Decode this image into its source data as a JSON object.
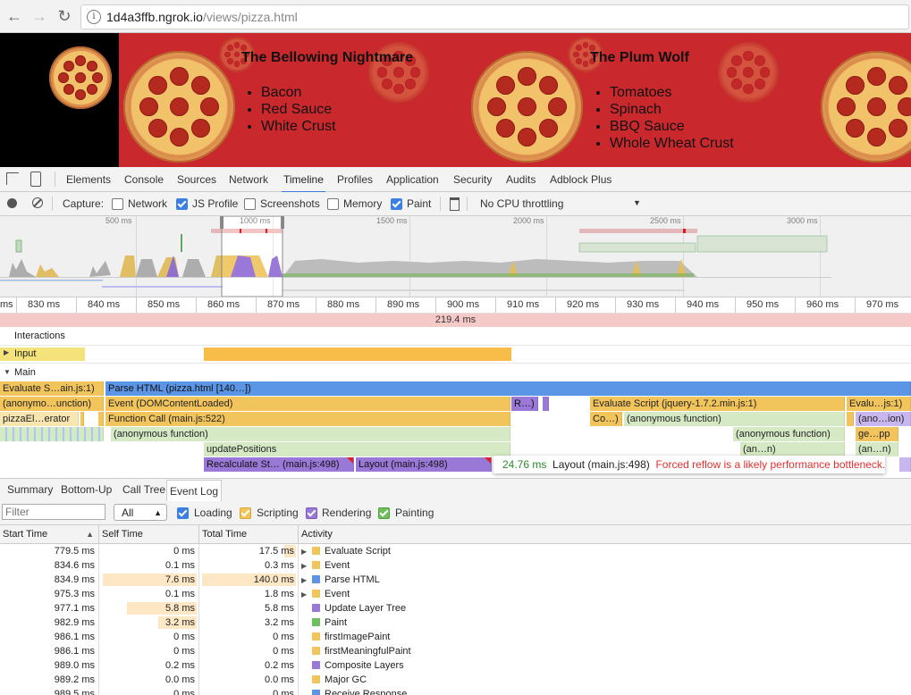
{
  "browser": {
    "url_host": "1d4a3ffb.ngrok.io",
    "url_path": "/views/pizza.html"
  },
  "page": {
    "pizzas": [
      {
        "name": "The Bellowing Nightmare",
        "ingredients": [
          "Bacon",
          "Red Sauce",
          "White Crust"
        ]
      },
      {
        "name": "The Plum Wolf",
        "ingredients": [
          "Tomatoes",
          "Spinach",
          "BBQ Sauce",
          "Whole Wheat Crust"
        ]
      }
    ]
  },
  "devtools": {
    "tabs": [
      "Elements",
      "Console",
      "Sources",
      "Network",
      "Timeline",
      "Profiles",
      "Application",
      "Security",
      "Audits",
      "Adblock Plus"
    ],
    "active_tab": "Timeline",
    "capture": {
      "label": "Capture:",
      "options": [
        {
          "label": "Network",
          "checked": false
        },
        {
          "label": "JS Profile",
          "checked": true
        },
        {
          "label": "Screenshots",
          "checked": false
        },
        {
          "label": "Memory",
          "checked": false
        },
        {
          "label": "Paint",
          "checked": true
        }
      ],
      "throttling": "No CPU throttling"
    },
    "overview_ticks": [
      "500 ms",
      "1000 ms",
      "1500 ms",
      "2000 ms",
      "2500 ms",
      "3000 ms"
    ],
    "ruler_ticks": [
      "ms",
      "830 ms",
      "840 ms",
      "850 ms",
      "860 ms",
      "870 ms",
      "880 ms",
      "890 ms",
      "900 ms",
      "910 ms",
      "920 ms",
      "930 ms",
      "940 ms",
      "950 ms",
      "960 ms",
      "970 ms"
    ],
    "selection_duration": "219.4 ms",
    "tracks": {
      "interactions": "Interactions",
      "input": "Input",
      "main": "Main"
    },
    "flame": {
      "evaluate_script_1": "Evaluate S…ain.js:1)",
      "parse_html": "Parse HTML (pizza.html [140…])",
      "anon_function_1": "(anonymo…unction)",
      "event_dom": "Event (DOMContentLoaded)",
      "r_short": "R…)",
      "evaluate_jquery": "Evaluate Script (jquery-1.7.2.min.js:1)",
      "evalu_js1": "Evalu…js:1)",
      "pizza_gen": "pizzaEl…erator",
      "function_call": "Function Call (main.js:522)",
      "co_short": "Co…)",
      "anon_function_2": "(anonymous function)",
      "ano_ion": "(ano…ion)",
      "anon_function_3": "(anonymous function)",
      "anon_function_4": "(anonymous function)",
      "ge_pp": "ge…pp",
      "update_positions": "updatePositions",
      "an_n_1": "(an…n)",
      "an_n_2": "(an…n)",
      "recalc": "Recalculate St… (main.js:498)",
      "layout": "Layout (main.js:498)"
    },
    "tooltip": {
      "time": "24.76 ms",
      "title": "Layout (main.js:498)",
      "warning": "Forced reflow is a likely performance bottleneck.",
      "time_color": "#2a8a2a",
      "warning_color": "#e03030"
    },
    "subtabs": [
      "Summary",
      "Bottom-Up",
      "Call Tree",
      "Event Log"
    ],
    "active_subtab": "Event Log",
    "filter_placeholder": "Filter",
    "filter_select": "All",
    "categories": [
      {
        "label": "Loading",
        "checked": true
      },
      {
        "label": "Scripting",
        "checked": true
      },
      {
        "label": "Rendering",
        "checked": true
      },
      {
        "label": "Painting",
        "checked": true
      }
    ],
    "columns": [
      "Start Time",
      "Self Time",
      "Total Time",
      "Activity"
    ],
    "rows": [
      {
        "start": "779.5 ms",
        "self": "0 ms",
        "total": "17.5 ms",
        "activity": "Evaluate Script",
        "expand": true,
        "color": "#f2c55c",
        "self_bar": 0,
        "total_bar": 0.12
      },
      {
        "start": "834.6 ms",
        "self": "0.1 ms",
        "total": "0.3 ms",
        "activity": "Event",
        "expand": true,
        "color": "#f2c55c",
        "self_bar": 0,
        "total_bar": 0
      },
      {
        "start": "834.9 ms",
        "self": "7.6 ms",
        "total": "140.0 ms",
        "activity": "Parse HTML",
        "expand": true,
        "color": "#5b95e6",
        "self_bar": 0.97,
        "total_bar": 0.97
      },
      {
        "start": "975.3 ms",
        "self": "0.1 ms",
        "total": "1.8 ms",
        "activity": "Event",
        "expand": true,
        "color": "#f2c55c",
        "self_bar": 0,
        "total_bar": 0
      },
      {
        "start": "977.1 ms",
        "self": "5.8 ms",
        "total": "5.8 ms",
        "activity": "Update Layer Tree",
        "expand": false,
        "color": "#9a78d8",
        "self_bar": 0.72,
        "total_bar": 0
      },
      {
        "start": "982.9 ms",
        "self": "3.2 ms",
        "total": "3.2 ms",
        "activity": "Paint",
        "expand": false,
        "color": "#6fbf5c",
        "self_bar": 0.4,
        "total_bar": 0
      },
      {
        "start": "986.1 ms",
        "self": "0 ms",
        "total": "0 ms",
        "activity": "firstImagePaint",
        "expand": false,
        "color": "#f2c55c",
        "self_bar": 0,
        "total_bar": 0
      },
      {
        "start": "986.1 ms",
        "self": "0 ms",
        "total": "0 ms",
        "activity": "firstMeaningfulPaint",
        "expand": false,
        "color": "#f2c55c",
        "self_bar": 0,
        "total_bar": 0
      },
      {
        "start": "989.0 ms",
        "self": "0.2 ms",
        "total": "0.2 ms",
        "activity": "Composite Layers",
        "expand": false,
        "color": "#9a78d8",
        "self_bar": 0,
        "total_bar": 0
      },
      {
        "start": "989.2 ms",
        "self": "0.0 ms",
        "total": "0.0 ms",
        "activity": "Major GC",
        "expand": false,
        "color": "#f2c55c",
        "self_bar": 0,
        "total_bar": 0
      },
      {
        "start": "989.5 ms",
        "self": "0 ms",
        "total": "0 ms",
        "activity": "Receive Response",
        "expand": false,
        "color": "#5b95e6",
        "self_bar": 0,
        "total_bar": 0
      }
    ]
  }
}
